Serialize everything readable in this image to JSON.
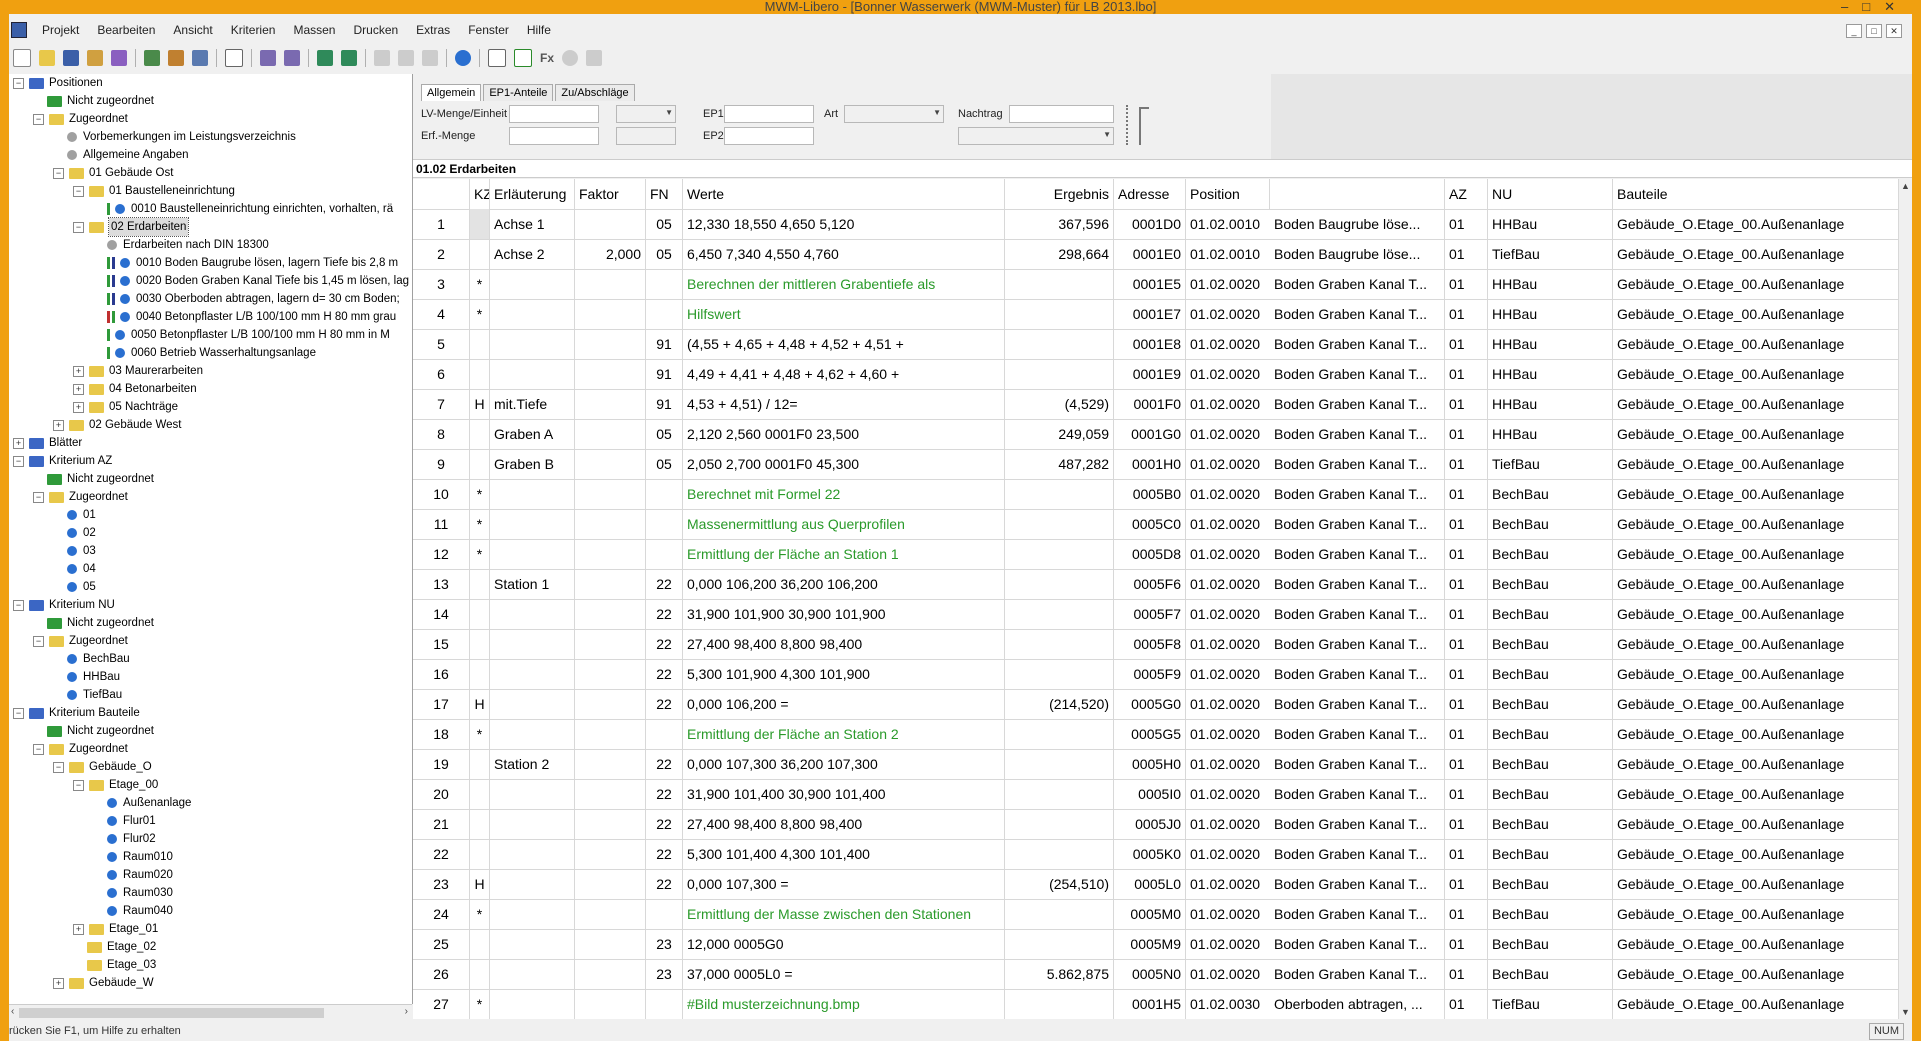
{
  "window": {
    "title": "MWM-Libero - [Bonner Wasserwerk (MWM-Muster) für LB 2013.lbo]"
  },
  "menu": [
    "Projekt",
    "Bearbeiten",
    "Ansicht",
    "Kriterien",
    "Massen",
    "Drucken",
    "Extras",
    "Fenster",
    "Hilfe"
  ],
  "toolbar": {
    "fx_label": "Fx"
  },
  "colors": {
    "accent_frame": "#f0a010",
    "green_text": "#2a9a2a",
    "folder_yellow": "#e8c84a",
    "folder_blue": "#3b66c4",
    "folder_green": "#2f9a3a",
    "ball_blue": "#2a6fd0"
  },
  "tree": [
    {
      "label": "Positionen",
      "exp": "−",
      "icon": "folder-blue"
    },
    {
      "label": "Nicht zugeordnet",
      "exp": "",
      "icon": "folder-green"
    },
    {
      "label": "Zugeordnet",
      "exp": "−",
      "icon": "folder-yellow"
    },
    {
      "label": "Vorbemerkungen im Leistungsverzeichnis",
      "exp": "",
      "icon": "ball-grey"
    },
    {
      "label": "Allgemeine Angaben",
      "exp": "",
      "icon": "ball-grey"
    },
    {
      "label": "01 Gebäude Ost",
      "exp": "−",
      "icon": "folder-yellow"
    },
    {
      "label": "01 Baustelleneinrichtung",
      "exp": "−",
      "icon": "folder-yellow"
    },
    {
      "label": "0010   Baustelleneinrichtung einrichten, vorhalten, rä",
      "exp": "",
      "icon": "ball-bars-g"
    },
    {
      "label": "02 Erdarbeiten",
      "exp": "−",
      "icon": "folder-yellow",
      "selected": true
    },
    {
      "label": "Erdarbeiten nach DIN 18300",
      "exp": "",
      "icon": "ball-grey"
    },
    {
      "label": "0010   Boden Baugrube lösen, lagern Tiefe bis 2,8 m",
      "exp": "",
      "icon": "ball-bars-gb"
    },
    {
      "label": "0020   Boden Graben Kanal Tiefe bis 1,45 m lösen, lag",
      "exp": "",
      "icon": "ball-bars-gb"
    },
    {
      "label": "0030   Oberboden abtragen, lagern d= 30 cm Boden;",
      "exp": "",
      "icon": "ball-bars-gb"
    },
    {
      "label": "0040   Betonpflaster L/B 100/100 mm H 80 mm  grau",
      "exp": "",
      "icon": "ball-bars-rg"
    },
    {
      "label": "0050   Betonpflaster L/B 100/100 mm H 80 mm  in M",
      "exp": "",
      "icon": "ball-bars-g"
    },
    {
      "label": "0060   Betrieb Wasserhaltungsanlage",
      "exp": "",
      "icon": "ball-bars-g"
    },
    {
      "label": "03 Maurerarbeiten",
      "exp": "+",
      "icon": "folder-yellow"
    },
    {
      "label": "04 Betonarbeiten",
      "exp": "+",
      "icon": "folder-yellow"
    },
    {
      "label": "05 Nachträge",
      "exp": "+",
      "icon": "folder-yellow"
    },
    {
      "label": "02 Gebäude West",
      "exp": "+",
      "icon": "folder-yellow"
    },
    {
      "label": "Blätter",
      "exp": "+",
      "icon": "folder-blue"
    },
    {
      "label": "Kriterium AZ",
      "exp": "−",
      "icon": "folder-blue"
    },
    {
      "label": "Nicht zugeordnet",
      "exp": "",
      "icon": "folder-green"
    },
    {
      "label": "Zugeordnet",
      "exp": "−",
      "icon": "folder-yellow"
    },
    {
      "label": "01",
      "exp": "",
      "icon": "ball-blue"
    },
    {
      "label": "02",
      "exp": "",
      "icon": "ball-blue"
    },
    {
      "label": "03",
      "exp": "",
      "icon": "ball-blue"
    },
    {
      "label": "04",
      "exp": "",
      "icon": "ball-blue"
    },
    {
      "label": "05",
      "exp": "",
      "icon": "ball-blue"
    },
    {
      "label": "Kriterium NU",
      "exp": "−",
      "icon": "folder-blue"
    },
    {
      "label": "Nicht zugeordnet",
      "exp": "",
      "icon": "folder-green"
    },
    {
      "label": "Zugeordnet",
      "exp": "−",
      "icon": "folder-yellow"
    },
    {
      "label": "BechBau",
      "exp": "",
      "icon": "ball-blue"
    },
    {
      "label": "HHBau",
      "exp": "",
      "icon": "ball-blue"
    },
    {
      "label": "TiefBau",
      "exp": "",
      "icon": "ball-blue"
    },
    {
      "label": "Kriterium Bauteile",
      "exp": "−",
      "icon": "folder-blue"
    },
    {
      "label": "Nicht zugeordnet",
      "exp": "",
      "icon": "folder-green"
    },
    {
      "label": "Zugeordnet",
      "exp": "−",
      "icon": "folder-yellow"
    },
    {
      "label": "Gebäude_O",
      "exp": "−",
      "icon": "folder-yellow"
    },
    {
      "label": "Etage_00",
      "exp": "−",
      "icon": "folder-yellow"
    },
    {
      "label": "Außenanlage",
      "exp": "",
      "icon": "ball-blue"
    },
    {
      "label": "Flur01",
      "exp": "",
      "icon": "ball-blue"
    },
    {
      "label": "Flur02",
      "exp": "",
      "icon": "ball-blue"
    },
    {
      "label": "Raum010",
      "exp": "",
      "icon": "ball-blue"
    },
    {
      "label": "Raum020",
      "exp": "",
      "icon": "ball-blue"
    },
    {
      "label": "Raum030",
      "exp": "",
      "icon": "ball-blue"
    },
    {
      "label": "Raum040",
      "exp": "",
      "icon": "ball-blue"
    },
    {
      "label": "Etage_01",
      "exp": "+",
      "icon": "folder-yellow"
    },
    {
      "label": "Etage_02",
      "exp": "",
      "icon": "folder-yellow"
    },
    {
      "label": "Etage_03",
      "exp": "",
      "icon": "folder-yellow"
    },
    {
      "label": "Gebäude_W",
      "exp": "+",
      "icon": "folder-yellow"
    }
  ],
  "tabs": [
    "Allgemein",
    "EP1-Anteile",
    "Zu/Abschläge"
  ],
  "fields": {
    "lv_menge": "LV-Menge/Einheit",
    "erf_menge": "Erf.-Menge",
    "ep1": "EP1",
    "ep2": "EP2",
    "art": "Art",
    "nachtrag": "Nachtrag"
  },
  "section_title": "01.02  Erdarbeiten",
  "columns": [
    "KZ",
    "Erläuterung",
    "Faktor",
    "FN",
    "Werte",
    "Ergebnis",
    "Adresse",
    "Position",
    "",
    "AZ",
    "NU",
    "Bauteile"
  ],
  "rows": [
    {
      "n": "1",
      "kz": "",
      "erl": "Achse 1",
      "faktor": "",
      "fn": "05",
      "werte": "12,330 18,550 4,650 5,120",
      "green": false,
      "erg": "367,596",
      "adr": "0001D0",
      "pos": "01.02.0010",
      "postext": "Boden Baugrube löse...",
      "az": "01",
      "nu": "HHBau",
      "bt": "Gebäude_O.Etage_00.Außenanlage"
    },
    {
      "n": "2",
      "kz": "",
      "erl": "Achse 2",
      "faktor": "2,000",
      "fn": "05",
      "werte": "6,450 7,340 4,550 4,760",
      "green": false,
      "erg": "298,664",
      "adr": "0001E0",
      "pos": "01.02.0010",
      "postext": "Boden Baugrube löse...",
      "az": "01",
      "nu": "TiefBau",
      "bt": "Gebäude_O.Etage_00.Außenanlage"
    },
    {
      "n": "3",
      "kz": "*",
      "erl": "",
      "faktor": "",
      "fn": "",
      "werte": "Berechnen der mittleren Grabentiefe als",
      "green": true,
      "erg": "",
      "adr": "0001E5",
      "pos": "01.02.0020",
      "postext": "Boden Graben Kanal T...",
      "az": "01",
      "nu": "HHBau",
      "bt": "Gebäude_O.Etage_00.Außenanlage"
    },
    {
      "n": "4",
      "kz": "*",
      "erl": "",
      "faktor": "",
      "fn": "",
      "werte": "Hilfswert",
      "green": true,
      "erg": "",
      "adr": "0001E7",
      "pos": "01.02.0020",
      "postext": "Boden Graben Kanal T...",
      "az": "01",
      "nu": "HHBau",
      "bt": "Gebäude_O.Etage_00.Außenanlage"
    },
    {
      "n": "5",
      "kz": "",
      "erl": "",
      "faktor": "",
      "fn": "91",
      "werte": "(4,55 + 4,65 + 4,48 + 4,52 + 4,51 +",
      "green": false,
      "erg": "",
      "adr": "0001E8",
      "pos": "01.02.0020",
      "postext": "Boden Graben Kanal T...",
      "az": "01",
      "nu": "HHBau",
      "bt": "Gebäude_O.Etage_00.Außenanlage"
    },
    {
      "n": "6",
      "kz": "",
      "erl": "",
      "faktor": "",
      "fn": "91",
      "werte": "4,49 + 4,41 + 4,48 + 4,62 + 4,60 +",
      "green": false,
      "erg": "",
      "adr": "0001E9",
      "pos": "01.02.0020",
      "postext": "Boden Graben Kanal T...",
      "az": "01",
      "nu": "HHBau",
      "bt": "Gebäude_O.Etage_00.Außenanlage"
    },
    {
      "n": "7",
      "kz": "H",
      "erl": "mit.Tiefe",
      "faktor": "",
      "fn": "91",
      "werte": "4,53 + 4,51) / 12=",
      "green": false,
      "erg": "(4,529)",
      "adr": "0001F0",
      "pos": "01.02.0020",
      "postext": "Boden Graben Kanal T...",
      "az": "01",
      "nu": "HHBau",
      "bt": "Gebäude_O.Etage_00.Außenanlage"
    },
    {
      "n": "8",
      "kz": "",
      "erl": "Graben A",
      "faktor": "",
      "fn": "05",
      "werte": "2,120 2,560 0001F0 23,500",
      "green": false,
      "erg": "249,059",
      "adr": "0001G0",
      "pos": "01.02.0020",
      "postext": "Boden Graben Kanal T...",
      "az": "01",
      "nu": "HHBau",
      "bt": "Gebäude_O.Etage_00.Außenanlage"
    },
    {
      "n": "9",
      "kz": "",
      "erl": "Graben B",
      "faktor": "",
      "fn": "05",
      "werte": "2,050 2,700 0001F0 45,300",
      "green": false,
      "erg": "487,282",
      "adr": "0001H0",
      "pos": "01.02.0020",
      "postext": "Boden Graben Kanal T...",
      "az": "01",
      "nu": "TiefBau",
      "bt": "Gebäude_O.Etage_00.Außenanlage"
    },
    {
      "n": "10",
      "kz": "*",
      "erl": "",
      "faktor": "",
      "fn": "",
      "werte": "Berechnet mit Formel 22",
      "green": true,
      "erg": "",
      "adr": "0005B0",
      "pos": "01.02.0020",
      "postext": "Boden Graben Kanal T...",
      "az": "01",
      "nu": "BechBau",
      "bt": "Gebäude_O.Etage_00.Außenanlage"
    },
    {
      "n": "11",
      "kz": "*",
      "erl": "",
      "faktor": "",
      "fn": "",
      "werte": "Massenermittlung aus Querprofilen",
      "green": true,
      "erg": "",
      "adr": "0005C0",
      "pos": "01.02.0020",
      "postext": "Boden Graben Kanal T...",
      "az": "01",
      "nu": "BechBau",
      "bt": "Gebäude_O.Etage_00.Außenanlage"
    },
    {
      "n": "12",
      "kz": "*",
      "erl": "",
      "faktor": "",
      "fn": "",
      "werte": "Ermittlung der Fläche an Station 1",
      "green": true,
      "erg": "",
      "adr": "0005D8",
      "pos": "01.02.0020",
      "postext": "Boden Graben Kanal T...",
      "az": "01",
      "nu": "BechBau",
      "bt": "Gebäude_O.Etage_00.Außenanlage"
    },
    {
      "n": "13",
      "kz": "",
      "erl": "Station 1",
      "faktor": "",
      "fn": "22",
      "werte": "0,000 106,200 36,200 106,200",
      "green": false,
      "erg": "",
      "adr": "0005F6",
      "pos": "01.02.0020",
      "postext": "Boden Graben Kanal T...",
      "az": "01",
      "nu": "BechBau",
      "bt": "Gebäude_O.Etage_00.Außenanlage"
    },
    {
      "n": "14",
      "kz": "",
      "erl": "",
      "faktor": "",
      "fn": "22",
      "werte": "31,900 101,900 30,900 101,900",
      "green": false,
      "erg": "",
      "adr": "0005F7",
      "pos": "01.02.0020",
      "postext": "Boden Graben Kanal T...",
      "az": "01",
      "nu": "BechBau",
      "bt": "Gebäude_O.Etage_00.Außenanlage"
    },
    {
      "n": "15",
      "kz": "",
      "erl": "",
      "faktor": "",
      "fn": "22",
      "werte": "27,400 98,400 8,800 98,400",
      "green": false,
      "erg": "",
      "adr": "0005F8",
      "pos": "01.02.0020",
      "postext": "Boden Graben Kanal T...",
      "az": "01",
      "nu": "BechBau",
      "bt": "Gebäude_O.Etage_00.Außenanlage"
    },
    {
      "n": "16",
      "kz": "",
      "erl": "",
      "faktor": "",
      "fn": "22",
      "werte": "5,300 101,900 4,300 101,900",
      "green": false,
      "erg": "",
      "adr": "0005F9",
      "pos": "01.02.0020",
      "postext": "Boden Graben Kanal T...",
      "az": "01",
      "nu": "BechBau",
      "bt": "Gebäude_O.Etage_00.Außenanlage"
    },
    {
      "n": "17",
      "kz": "H",
      "erl": "",
      "faktor": "",
      "fn": "22",
      "werte": "0,000 106,200 =",
      "green": false,
      "erg": "(214,520)",
      "adr": "0005G0",
      "pos": "01.02.0020",
      "postext": "Boden Graben Kanal T...",
      "az": "01",
      "nu": "BechBau",
      "bt": "Gebäude_O.Etage_00.Außenanlage"
    },
    {
      "n": "18",
      "kz": "*",
      "erl": "",
      "faktor": "",
      "fn": "",
      "werte": "Ermittlung der Fläche an Station 2",
      "green": true,
      "erg": "",
      "adr": "0005G5",
      "pos": "01.02.0020",
      "postext": "Boden Graben Kanal T...",
      "az": "01",
      "nu": "BechBau",
      "bt": "Gebäude_O.Etage_00.Außenanlage"
    },
    {
      "n": "19",
      "kz": "",
      "erl": "Station 2",
      "faktor": "",
      "fn": "22",
      "werte": "0,000 107,300 36,200 107,300",
      "green": false,
      "erg": "",
      "adr": "0005H0",
      "pos": "01.02.0020",
      "postext": "Boden Graben Kanal T...",
      "az": "01",
      "nu": "BechBau",
      "bt": "Gebäude_O.Etage_00.Außenanlage"
    },
    {
      "n": "20",
      "kz": "",
      "erl": "",
      "faktor": "",
      "fn": "22",
      "werte": "31,900 101,400 30,900 101,400",
      "green": false,
      "erg": "",
      "adr": "0005I0",
      "pos": "01.02.0020",
      "postext": "Boden Graben Kanal T...",
      "az": "01",
      "nu": "BechBau",
      "bt": "Gebäude_O.Etage_00.Außenanlage"
    },
    {
      "n": "21",
      "kz": "",
      "erl": "",
      "faktor": "",
      "fn": "22",
      "werte": "27,400 98,400 8,800 98,400",
      "green": false,
      "erg": "",
      "adr": "0005J0",
      "pos": "01.02.0020",
      "postext": "Boden Graben Kanal T...",
      "az": "01",
      "nu": "BechBau",
      "bt": "Gebäude_O.Etage_00.Außenanlage"
    },
    {
      "n": "22",
      "kz": "",
      "erl": "",
      "faktor": "",
      "fn": "22",
      "werte": "5,300 101,400 4,300 101,400",
      "green": false,
      "erg": "",
      "adr": "0005K0",
      "pos": "01.02.0020",
      "postext": "Boden Graben Kanal T...",
      "az": "01",
      "nu": "BechBau",
      "bt": "Gebäude_O.Etage_00.Außenanlage"
    },
    {
      "n": "23",
      "kz": "H",
      "erl": "",
      "faktor": "",
      "fn": "22",
      "werte": "0,000 107,300 =",
      "green": false,
      "erg": "(254,510)",
      "adr": "0005L0",
      "pos": "01.02.0020",
      "postext": "Boden Graben Kanal T...",
      "az": "01",
      "nu": "BechBau",
      "bt": "Gebäude_O.Etage_00.Außenanlage"
    },
    {
      "n": "24",
      "kz": "*",
      "erl": "",
      "faktor": "",
      "fn": "",
      "werte": "Ermittlung der Masse zwischen den Stationen",
      "green": true,
      "erg": "",
      "adr": "0005M0",
      "pos": "01.02.0020",
      "postext": "Boden Graben Kanal T...",
      "az": "01",
      "nu": "BechBau",
      "bt": "Gebäude_O.Etage_00.Außenanlage"
    },
    {
      "n": "25",
      "kz": "",
      "erl": "",
      "faktor": "",
      "fn": "23",
      "werte": "12,000 0005G0",
      "green": false,
      "erg": "",
      "adr": "0005M9",
      "pos": "01.02.0020",
      "postext": "Boden Graben Kanal T...",
      "az": "01",
      "nu": "BechBau",
      "bt": "Gebäude_O.Etage_00.Außenanlage"
    },
    {
      "n": "26",
      "kz": "",
      "erl": "",
      "faktor": "",
      "fn": "23",
      "werte": "37,000 0005L0 =",
      "green": false,
      "erg": "5.862,875",
      "adr": "0005N0",
      "pos": "01.02.0020",
      "postext": "Boden Graben Kanal T...",
      "az": "01",
      "nu": "BechBau",
      "bt": "Gebäude_O.Etage_00.Außenanlage"
    },
    {
      "n": "27",
      "kz": "*",
      "erl": "",
      "faktor": "",
      "fn": "",
      "werte": "#Bild musterzeichnung.bmp",
      "green": true,
      "erg": "",
      "adr": "0001H5",
      "pos": "01.02.0030",
      "postext": "Oberboden abtragen, ...",
      "az": "01",
      "nu": "TiefBau",
      "bt": "Gebäude_O.Etage_00.Außenanlage"
    }
  ],
  "status": {
    "text": "rücken Sie F1, um Hilfe zu erhalten",
    "num": "NUM"
  }
}
